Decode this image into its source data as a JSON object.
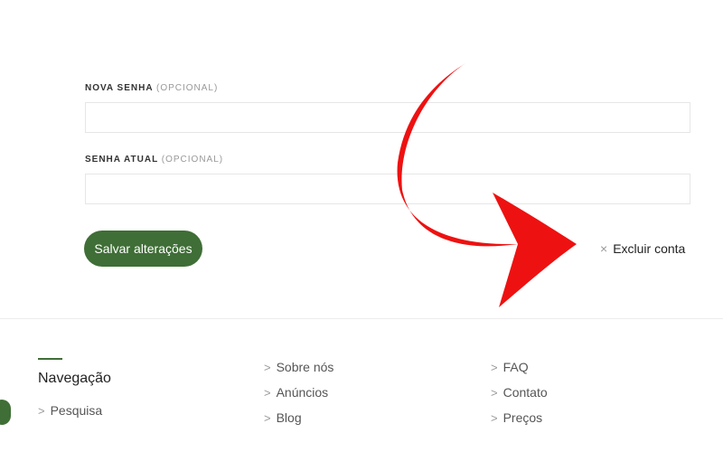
{
  "form": {
    "new_password": {
      "label": "NOVA SENHA",
      "optional": "(OPCIONAL)",
      "value": ""
    },
    "current_password": {
      "label": "SENHA ATUAL",
      "optional": "(OPCIONAL)",
      "value": ""
    },
    "save_label": "Salvar alterações",
    "delete_label": "Excluir conta",
    "delete_icon": "×"
  },
  "footer": {
    "nav_title": "Navegação",
    "chevron": ">",
    "col1": [
      "Pesquisa"
    ],
    "col2": [
      "Sobre nós",
      "Anúncios",
      "Blog"
    ],
    "col3": [
      "FAQ",
      "Contato",
      "Preços"
    ]
  },
  "colors": {
    "accent_green": "#3f6e36",
    "arrow_red": "#ee1111"
  }
}
